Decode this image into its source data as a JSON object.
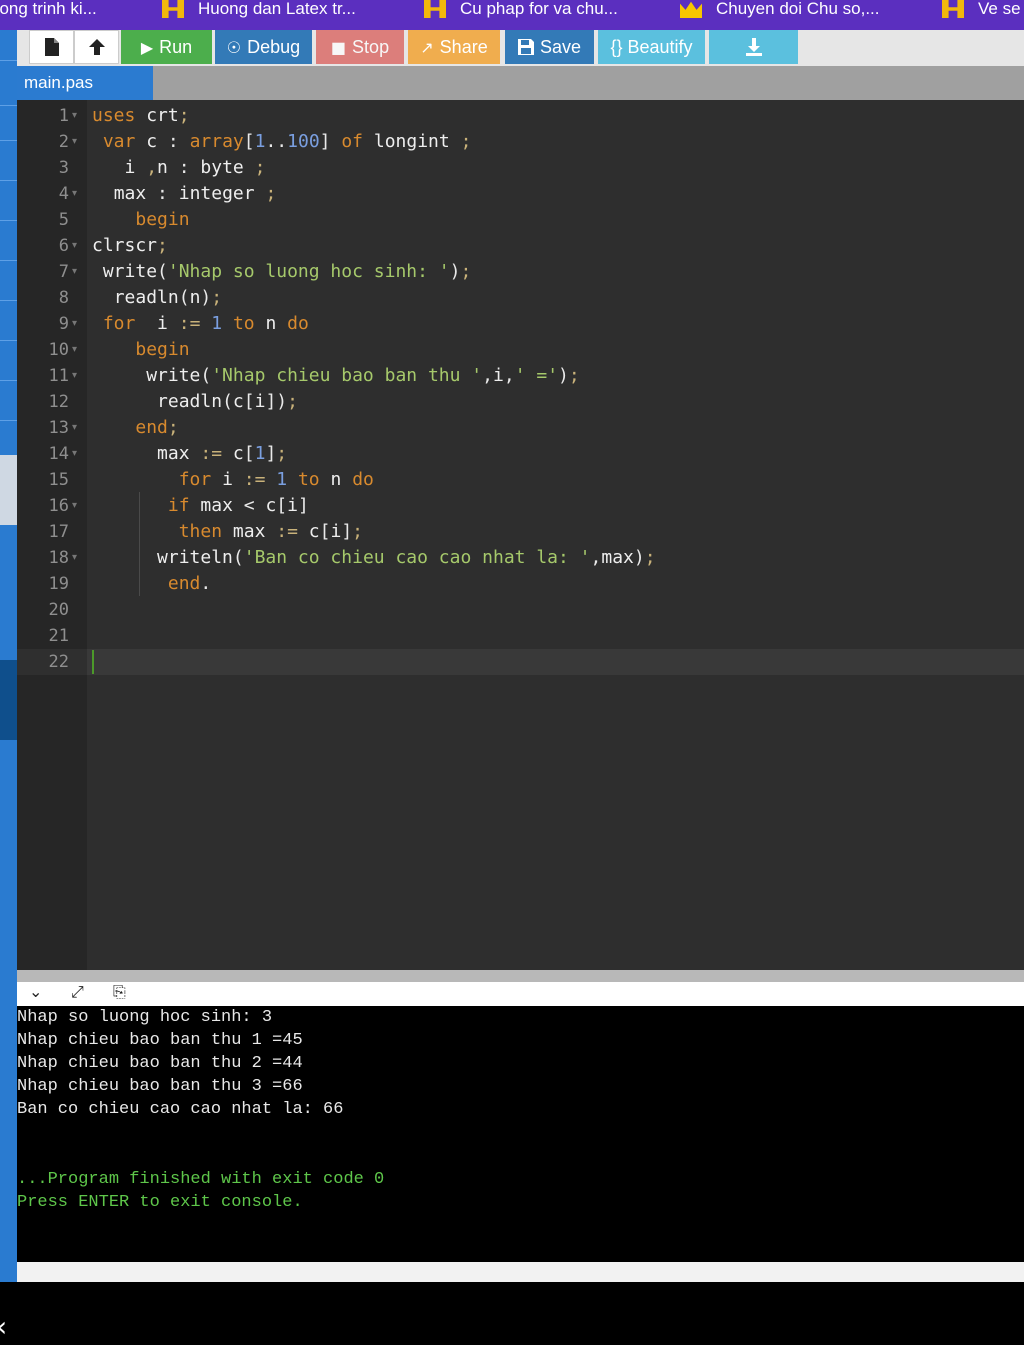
{
  "bookmarks": [
    {
      "label": "uong trinh ki...",
      "icon": "none"
    },
    {
      "label": "Huong dan Latex tr...",
      "icon": "h-icon"
    },
    {
      "label": "Cu phap for va chu...",
      "icon": "h-icon"
    },
    {
      "label": "Chuyen doi Chu so,...",
      "icon": "crown-icon"
    },
    {
      "label": "Ve se",
      "icon": "h-icon"
    }
  ],
  "toolbar": {
    "run_label": "Run",
    "debug_label": "Debug",
    "stop_label": "Stop",
    "share_label": "Share",
    "save_label": "Save",
    "beautify_label": "{} Beautify"
  },
  "tab": {
    "filename": "main.pas"
  },
  "editor": {
    "active_line": 22,
    "lines": [
      "uses crt;",
      " var c : array[1..100] of longint ;",
      "   i ,n : byte ;",
      "  max : integer ;",
      "    begin",
      "clrscr;",
      " write('Nhap so luong hoc sinh: ');",
      "  readln(n);",
      " for  i := 1 to n do",
      "    begin",
      "     write('Nhap chieu bao ban thu ',i,' =');",
      "      readln(c[i]);",
      "    end;",
      "      max := c[1];",
      "        for i := 1 to n do",
      "       if max < c[i]",
      "        then max := c[i];",
      "      writeln('Ban co chieu cao cao nhat la: ',max);",
      "       end.",
      "",
      "",
      ""
    ]
  },
  "console": {
    "lines": [
      "Nhap so luong hoc sinh: 3",
      "Nhap chieu bao ban thu 1 =45",
      "Nhap chieu bao ban thu 2 =44",
      "Nhap chieu bao ban thu 3 =66",
      "Ban co chieu cao cao nhat la: 66"
    ],
    "finish_line": "...Program finished with exit code 0",
    "press_line": "Press ENTER to exit console."
  },
  "colors": {
    "bookmarks_bg": "#5b2fbf",
    "run": "#4cae4c",
    "debug": "#337ab7",
    "stop": "#d9534f",
    "share": "#f0ad4e",
    "save": "#337ab7",
    "beautify": "#5bc0de",
    "editor_bg": "#2e2e2e",
    "console_green": "#5ec64a"
  }
}
